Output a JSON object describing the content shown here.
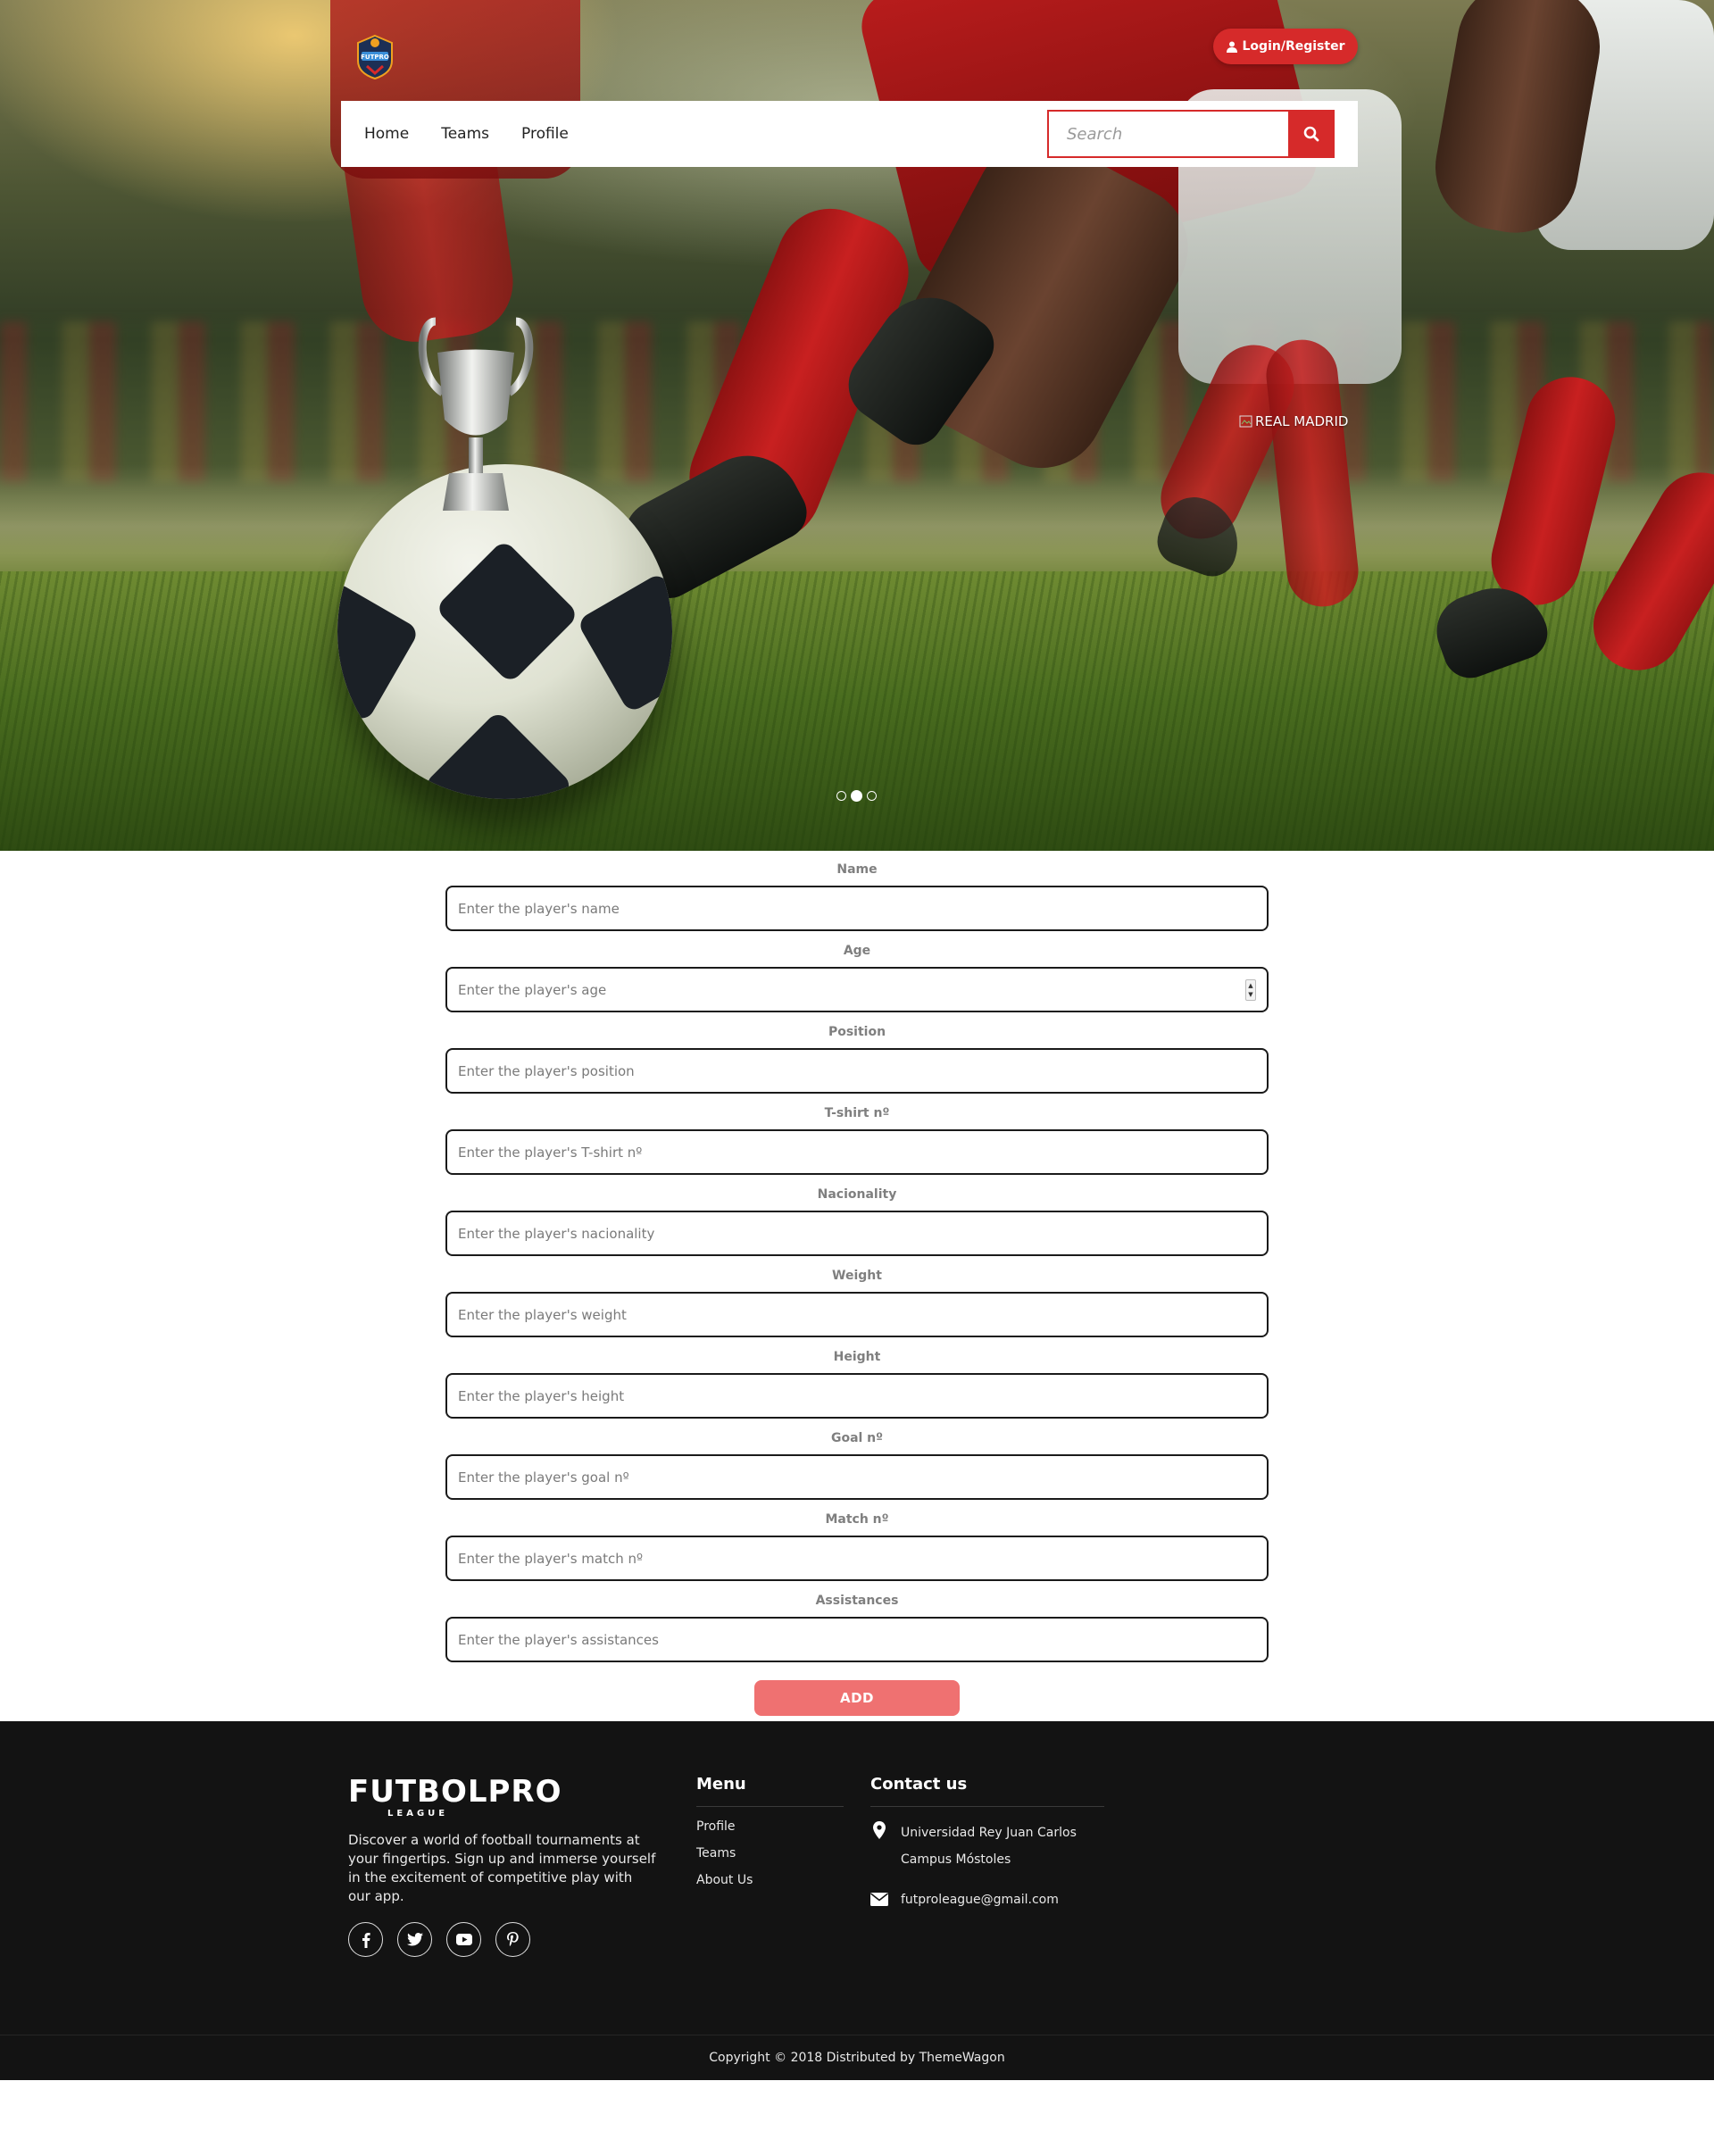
{
  "header": {
    "login_label": "Login/Register",
    "logo_text": "FUTPRO",
    "nav": [
      {
        "label": "Home"
      },
      {
        "label": "Teams"
      },
      {
        "label": "Profile"
      }
    ],
    "search_placeholder": "Search"
  },
  "hero": {
    "broken_image_alt": "REAL MADRID",
    "carousel_dots": 3,
    "active_dot": 2
  },
  "form": {
    "fields": [
      {
        "label": "Name",
        "placeholder": "Enter the player's name"
      },
      {
        "label": "Age",
        "placeholder": "Enter the player's age"
      },
      {
        "label": "Position",
        "placeholder": "Enter the player's position"
      },
      {
        "label": "T-shirt nº",
        "placeholder": "Enter the player's T-shirt nº"
      },
      {
        "label": "Nacionality",
        "placeholder": "Enter the player's nacionality"
      },
      {
        "label": "Weight",
        "placeholder": "Enter the player's weight"
      },
      {
        "label": "Height",
        "placeholder": "Enter the player's height"
      },
      {
        "label": "Goal nº",
        "placeholder": "Enter the player's goal nº"
      },
      {
        "label": "Match nº",
        "placeholder": "Enter the player's match nº"
      },
      {
        "label": "Assistances",
        "placeholder": "Enter the player's assistances"
      }
    ],
    "submit_label": "ADD"
  },
  "footer": {
    "logo_main": "FUTBOLPRO",
    "logo_sub": "LEAGUE",
    "description": "Discover a world of football tournaments at your fingertips. Sign up and immerse yourself in the excitement of competitive play with our app.",
    "socials": [
      "facebook-icon",
      "twitter-icon",
      "youtube-icon",
      "pinterest-icon"
    ],
    "menu_title": "Menu",
    "menu_links": [
      {
        "label": "Profile"
      },
      {
        "label": "Teams"
      },
      {
        "label": "About Us"
      }
    ],
    "contact_title": "Contact us",
    "address": "Universidad Rey Juan Carlos Campus Móstoles",
    "email": "futproleague@gmail.com",
    "copyright": "Copyright © 2018 Distributed by ThemeWagon"
  },
  "colors": {
    "accent": "#d62a2a",
    "add_button": "#ef7171",
    "footer_bg": "#131313"
  }
}
